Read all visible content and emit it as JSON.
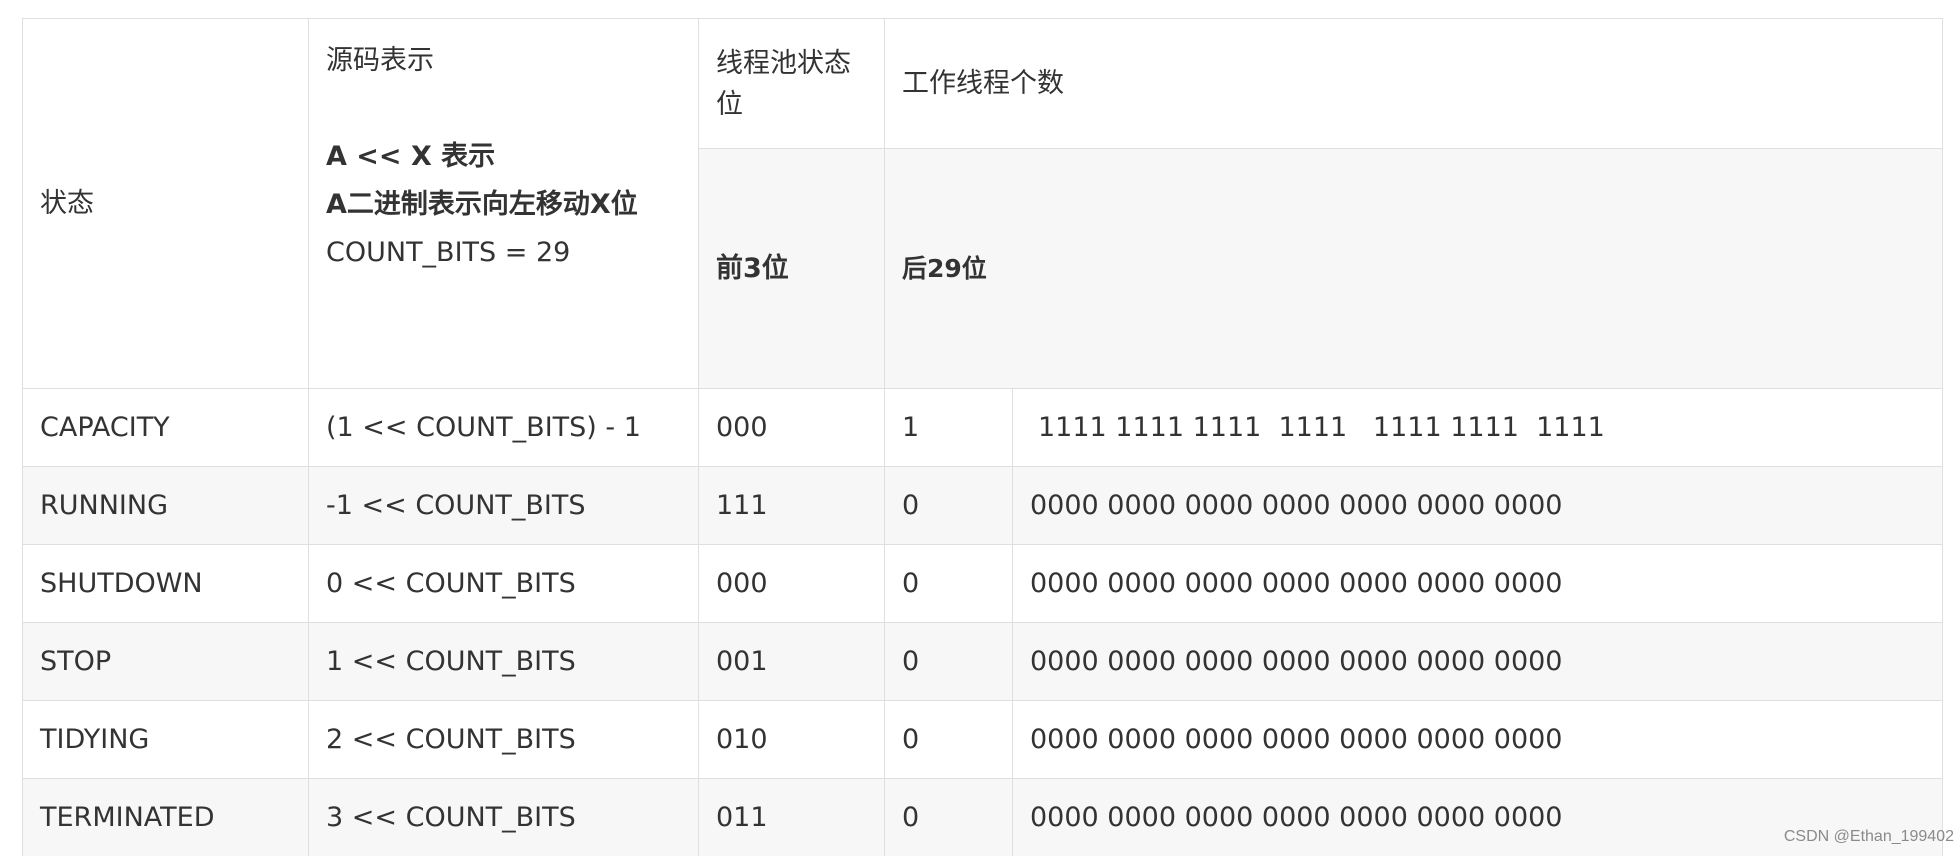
{
  "header": {
    "state": "状态",
    "source": {
      "title": "源码表示",
      "line1": "A << X 表示",
      "line2": "A二进制表示向左移动X位",
      "line3": "COUNT_BITS = 29"
    },
    "pool_status": "线程池状态位",
    "worker_count": "工作线程个数",
    "high_bits": "前3位",
    "low_bits": "后29位"
  },
  "rows": [
    {
      "state": "CAPACITY",
      "expr": "(1 << COUNT_BITS) - 1",
      "high": "000",
      "first": "1",
      "rest": "1111 1111 1111  1111   1111 1111  1111"
    },
    {
      "state": "RUNNING",
      "expr": "-1 << COUNT_BITS",
      "high": "111",
      "first": "0",
      "rest": "0000 0000 0000 0000 0000 0000 0000"
    },
    {
      "state": "SHUTDOWN",
      "expr": "0 << COUNT_BITS",
      "high": "000",
      "first": "0",
      "rest": "0000 0000 0000 0000 0000 0000 0000"
    },
    {
      "state": "STOP",
      "expr": "1 << COUNT_BITS",
      "high": "001",
      "first": "0",
      "rest": "0000 0000 0000 0000 0000 0000 0000"
    },
    {
      "state": "TIDYING",
      "expr": "2 << COUNT_BITS",
      "high": "010",
      "first": "0",
      "rest": "0000 0000 0000 0000 0000 0000 0000"
    },
    {
      "state": "TERMINATED",
      "expr": "3 << COUNT_BITS",
      "high": "011",
      "first": "0",
      "rest": "0000 0000 0000 0000 0000 0000 0000"
    }
  ],
  "watermark": "CSDN @Ethan_199402"
}
